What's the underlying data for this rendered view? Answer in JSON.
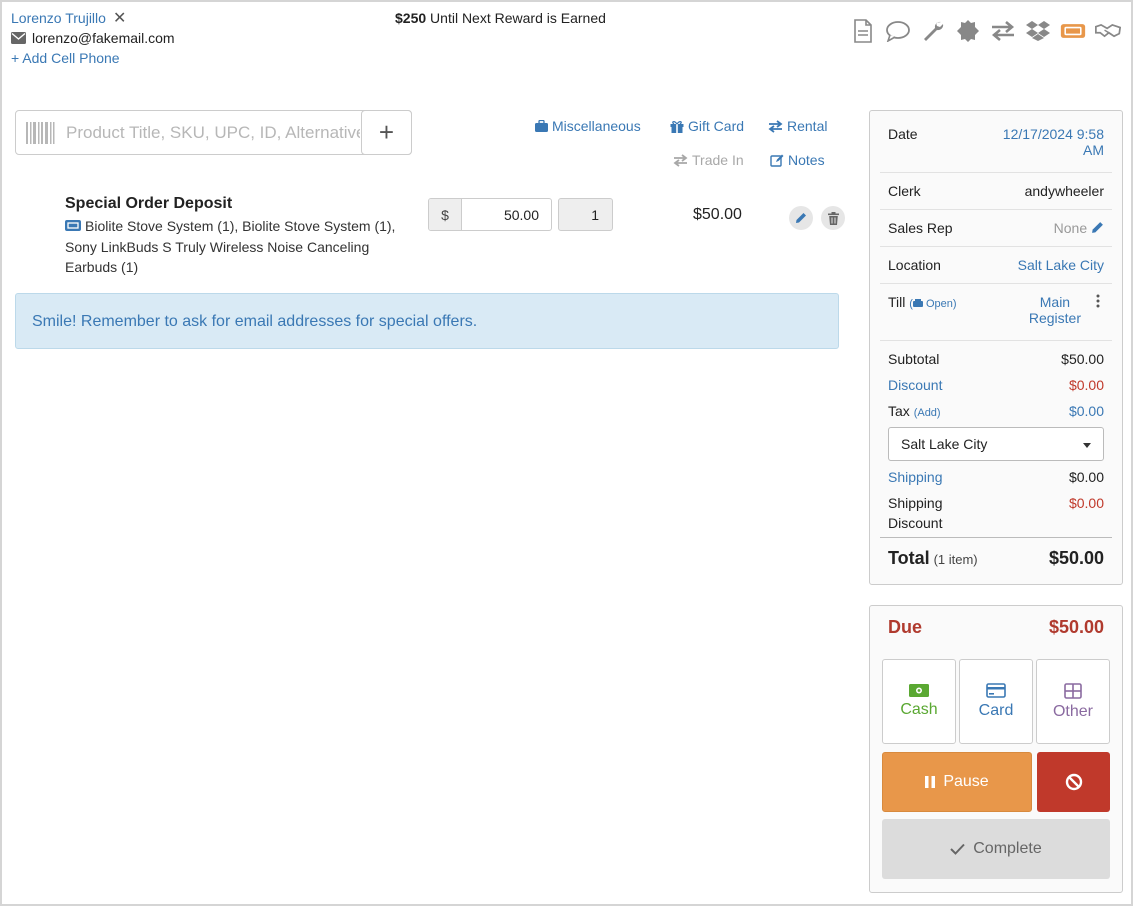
{
  "customer": {
    "name": "Lorenzo Trujillo",
    "email": "lorenzo@fakemail.com",
    "add_cell": "+ Add Cell Phone"
  },
  "reward": {
    "amount": "$250",
    "text": " Until Next Reward is Earned"
  },
  "toolbar_icons": [
    "document-icon",
    "chat-icon",
    "wrench-icon",
    "badge-icon",
    "transfer-icon",
    "dropbox-icon",
    "ticket-icon",
    "handshake-icon"
  ],
  "search": {
    "placeholder": "Product Title, SKU, UPC, ID, Alternative"
  },
  "quick_actions": {
    "misc": "Miscellaneous",
    "gift": "Gift Card",
    "rental": "Rental",
    "trade_in": "Trade In",
    "notes": "Notes"
  },
  "line_item": {
    "title": "Special Order Deposit",
    "description": "Biolite Stove System (1), Biolite Stove System (1), Sony LinkBuds S Truly Wireless Noise Canceling Earbuds (1)",
    "currency": "$",
    "price": "50.00",
    "qty": "1",
    "total": "$50.00"
  },
  "alert": "Smile! Remember to ask for email addresses for special offers.",
  "summary": {
    "date_label": "Date",
    "date_value_line1": "12/17/2024 9:58",
    "date_value_line2": "AM",
    "clerk_label": "Clerk",
    "clerk_value": "andywheeler",
    "salesrep_label": "Sales Rep",
    "salesrep_value": "None",
    "location_label": "Location",
    "location_value": "Salt Lake City",
    "till_label": "Till",
    "till_status": "Open",
    "till_value_line1": "Main",
    "till_value_line2": "Register",
    "subtotal_label": "Subtotal",
    "subtotal_value": "$50.00",
    "discount_label": "Discount",
    "discount_value": "$0.00",
    "tax_label": "Tax",
    "tax_add": "(Add)",
    "tax_value": "$0.00",
    "tax_location": "Salt Lake City",
    "shipping_label": "Shipping",
    "shipping_value": "$0.00",
    "ship_discount_line1": "Shipping",
    "ship_discount_line2": "Discount",
    "ship_discount_value": "$0.00",
    "total_label": "Total",
    "total_items": "(1 item)",
    "total_value": "$50.00"
  },
  "payment": {
    "due_label": "Due",
    "due_value": "$50.00",
    "cash": "Cash",
    "card": "Card",
    "other": "Other",
    "pause": "Pause",
    "complete": "Complete"
  },
  "colors": {
    "link": "#3a78b4",
    "cash": "#5aa832",
    "card": "#3a78b4",
    "other": "#8a6aa0",
    "pause": "#e8974a",
    "void": "#c0392b",
    "due": "#b03a2e",
    "ticket_icon": "#e8974a"
  }
}
